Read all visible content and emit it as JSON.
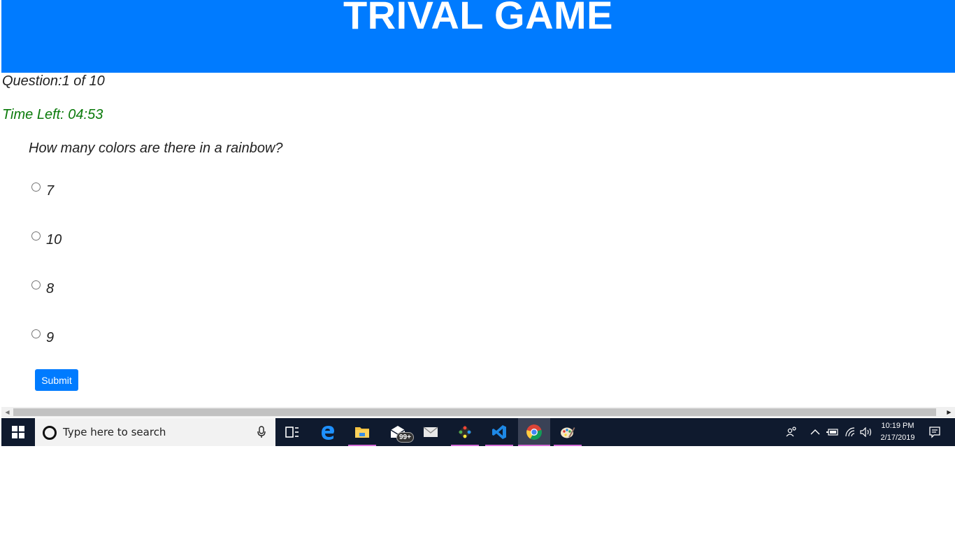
{
  "header": {
    "title": "TRIVAL GAME"
  },
  "quiz": {
    "counter": "Question:1 of 10",
    "timer": "Time Left: 04:53",
    "question": "How many colors are there in a rainbow?",
    "options": [
      "7",
      "10",
      "8",
      "9"
    ],
    "submit_label": "Submit"
  },
  "colors": {
    "header_bg": "#007bff",
    "timer_text": "#0a7a0a",
    "taskbar_bg": "#0f1a2e"
  },
  "taskbar": {
    "search_placeholder": "Type here to search",
    "mail_badge": "99+",
    "time": "10:19 PM",
    "date": "2/17/2019",
    "icons": [
      "windows-start-icon",
      "cortana-icon",
      "microphone-icon",
      "task-view-icon",
      "edge-icon",
      "file-explorer-icon",
      "mail-app-icon",
      "mail-icon",
      "git-icon",
      "vscode-icon",
      "chrome-icon",
      "paint-icon",
      "people-icon",
      "chevron-up-icon",
      "battery-icon",
      "wifi-icon",
      "volume-icon",
      "notification-icon"
    ]
  }
}
